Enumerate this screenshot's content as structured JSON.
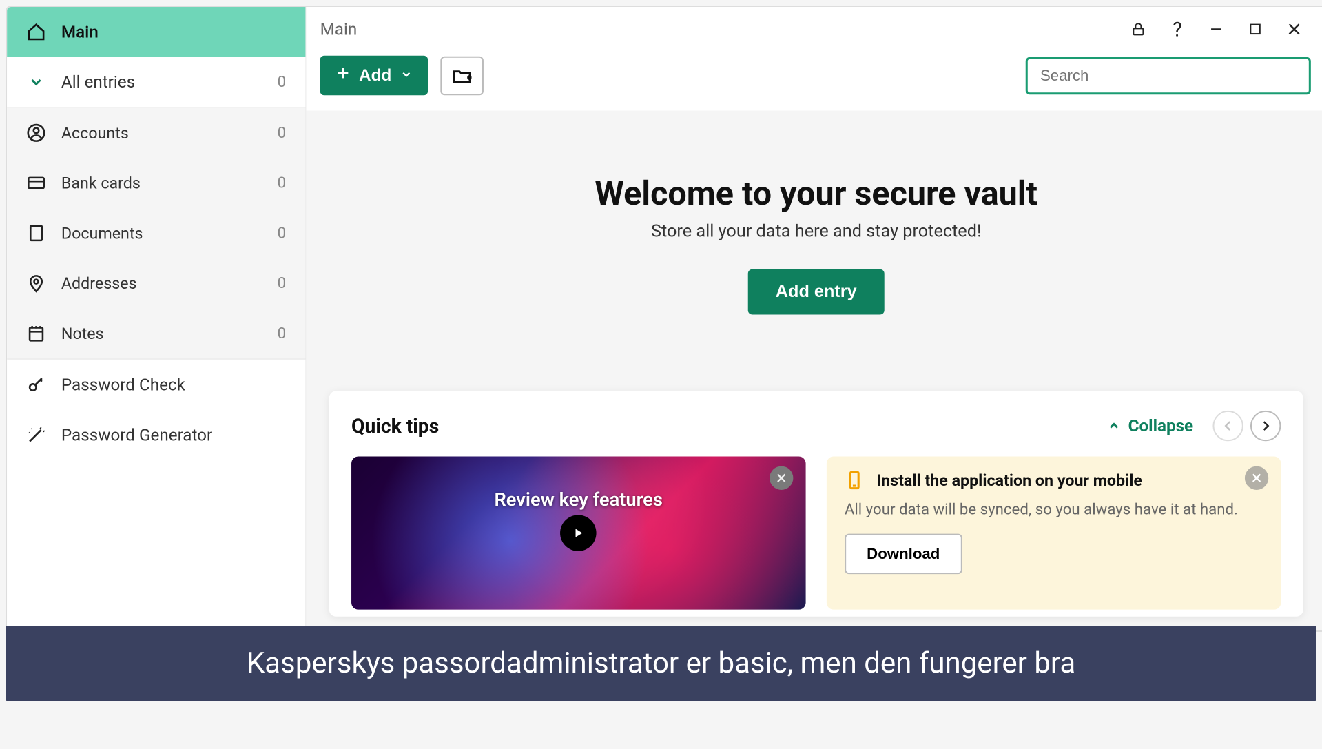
{
  "sidebar": {
    "main": "Main",
    "all_entries": {
      "label": "All entries",
      "count": "0"
    },
    "categories": [
      {
        "id": "accounts",
        "label": "Accounts",
        "count": "0"
      },
      {
        "id": "bankcards",
        "label": "Bank cards",
        "count": "0"
      },
      {
        "id": "documents",
        "label": "Documents",
        "count": "0"
      },
      {
        "id": "addresses",
        "label": "Addresses",
        "count": "0"
      },
      {
        "id": "notes",
        "label": "Notes",
        "count": "0"
      }
    ],
    "tools": {
      "password_check": "Password Check",
      "password_generator": "Password Generator"
    }
  },
  "header": {
    "breadcrumb": "Main"
  },
  "toolbar": {
    "add_label": "Add",
    "search_placeholder": "Search"
  },
  "welcome": {
    "title": "Welcome to your secure vault",
    "subtitle": "Store all your data here and stay protected!",
    "cta": "Add entry"
  },
  "tips": {
    "title": "Quick tips",
    "collapse": "Collapse",
    "video_title": "Review key features",
    "mobile": {
      "heading": "Install the application on your mobile",
      "desc": "All your data will be synced, so you always have it at hand.",
      "button": "Download"
    }
  },
  "caption": "Kasperskys passordadministrator er basic, men den fungerer bra"
}
